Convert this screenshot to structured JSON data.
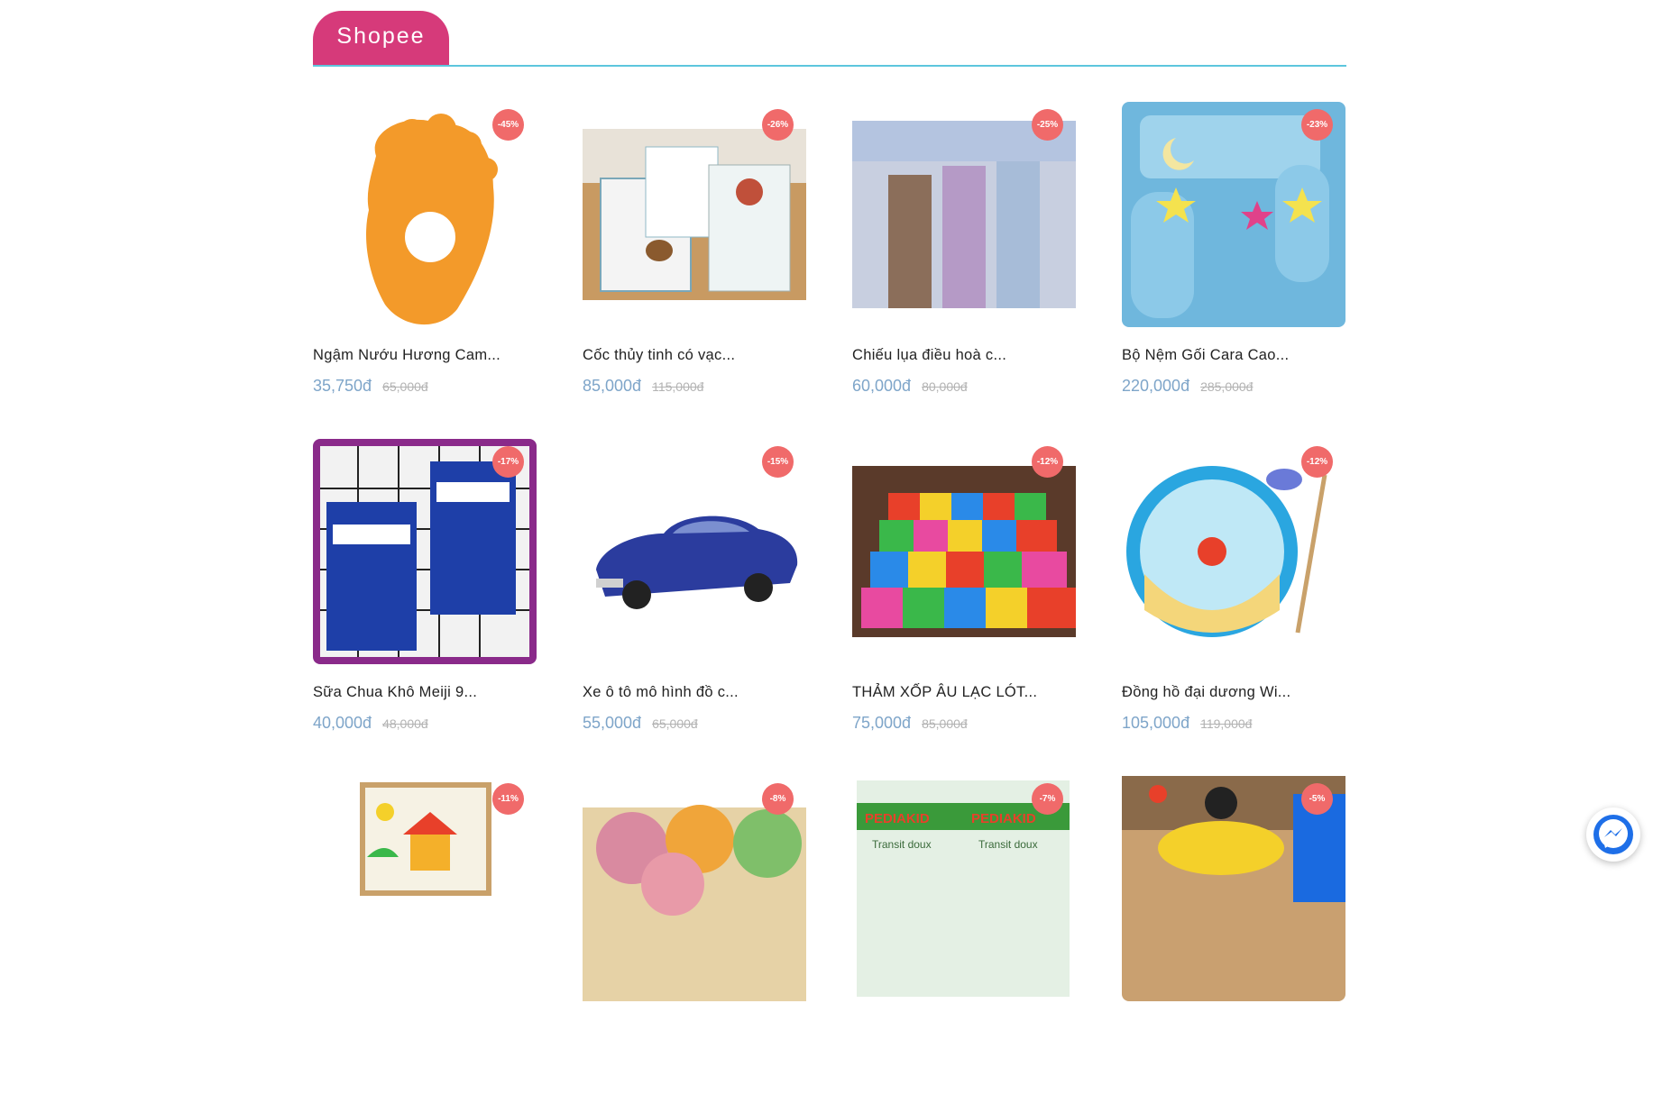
{
  "section": {
    "tab_label": "Shopee",
    "accent_color": "#d63a7a",
    "line_color": "#5cc6dd"
  },
  "products": [
    {
      "name": "Ngậm Nướu Hương Cam...",
      "price": "35,750đ",
      "old_price": "65,000đ",
      "discount": "-45%",
      "image": "orange-foot-teether"
    },
    {
      "name": "Cốc thủy tinh có vạc...",
      "price": "85,000đ",
      "old_price": "115,000đ",
      "discount": "-26%",
      "image": "glass-cup-boxes"
    },
    {
      "name": "Chiếu lụa điều hoà c...",
      "price": "60,000đ",
      "old_price": "80,000đ",
      "discount": "-25%",
      "image": "silk-mat-rolls"
    },
    {
      "name": "Bộ Nệm Gối Cara Cao...",
      "price": "220,000đ",
      "old_price": "285,000đ",
      "discount": "-23%",
      "image": "baby-bedding-set"
    },
    {
      "name": "Sữa Chua Khô Meiji 9...",
      "price": "40,000đ",
      "old_price": "48,000đ",
      "discount": "-17%",
      "image": "meiji-yogurt-packs"
    },
    {
      "name": "Xe ô tô mô hình đồ c...",
      "price": "55,000đ",
      "old_price": "65,000đ",
      "discount": "-15%",
      "image": "blue-toy-car"
    },
    {
      "name": "THẢM XỐP ÂU LẠC LÓT...",
      "price": "75,000đ",
      "old_price": "85,000đ",
      "discount": "-12%",
      "image": "foam-puzzle-mat"
    },
    {
      "name": "Đồng hồ đại dương Wi...",
      "price": "105,000đ",
      "old_price": "119,000đ",
      "discount": "-12%",
      "image": "ocean-clock-toy"
    },
    {
      "name": "",
      "price": "",
      "old_price": "",
      "discount": "-11%",
      "image": "magnetic-drawing-board"
    },
    {
      "name": "",
      "price": "",
      "old_price": "",
      "discount": "-8%",
      "image": "plush-bear-pillows"
    },
    {
      "name": "",
      "price": "",
      "old_price": "",
      "discount": "-7%",
      "image": "pediakid-boxes"
    },
    {
      "name": "",
      "price": "",
      "old_price": "",
      "discount": "-5%",
      "image": "kids-ride-on-car"
    }
  ],
  "messenger": {
    "icon": "messenger-icon"
  }
}
